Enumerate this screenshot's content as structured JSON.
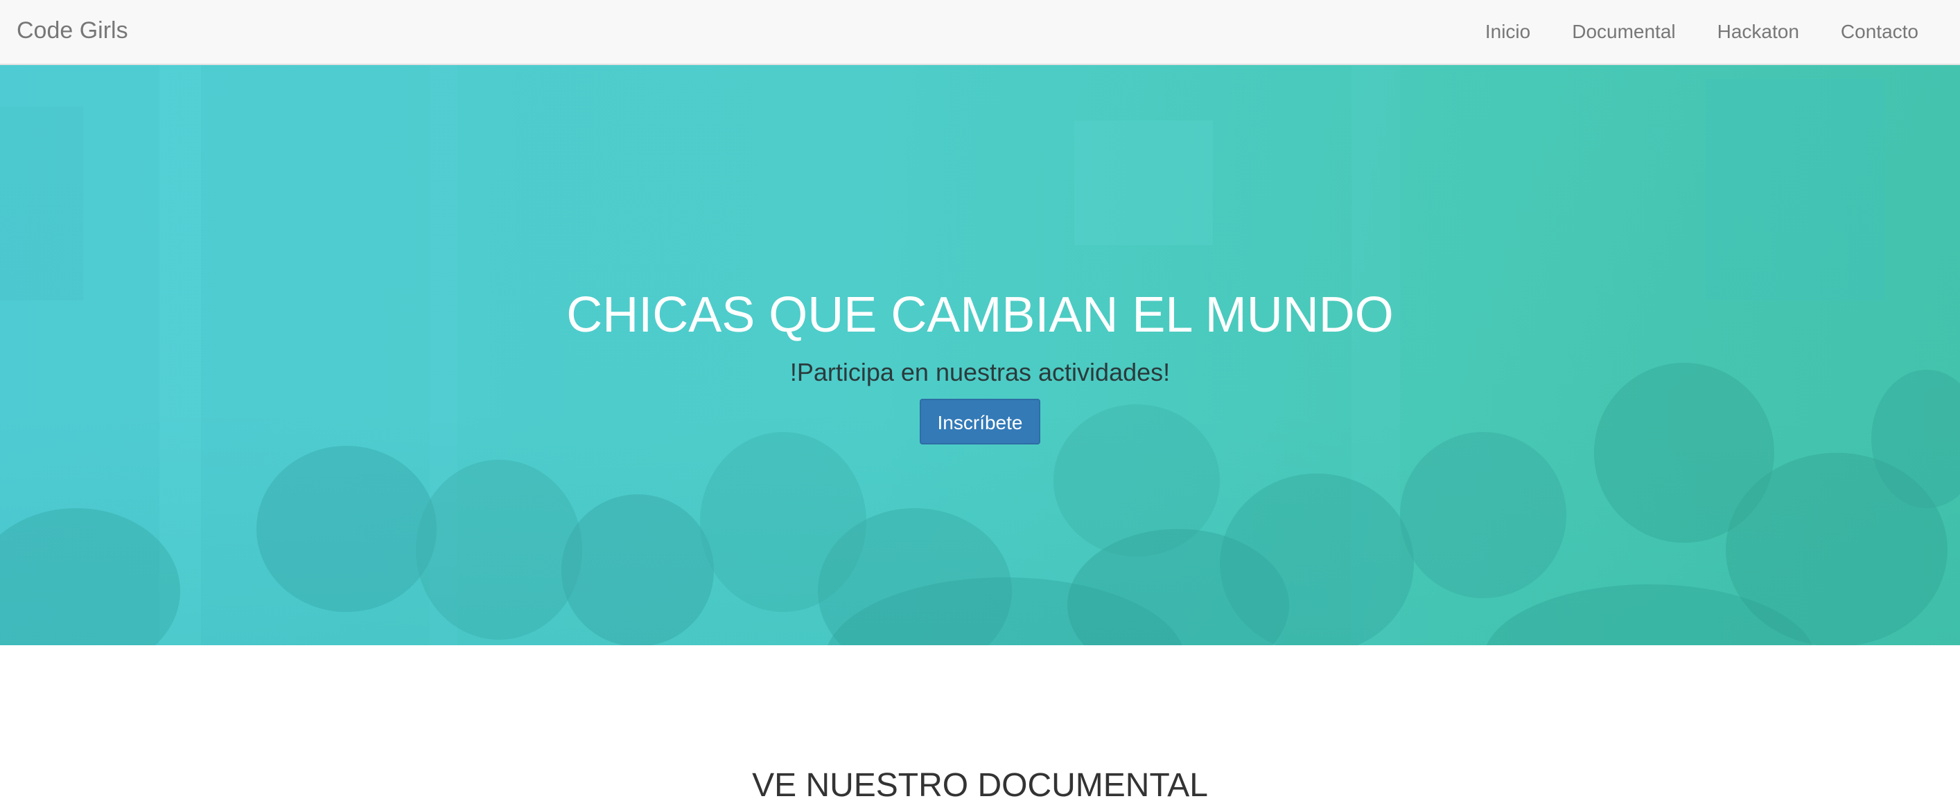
{
  "navbar": {
    "brand": "Code Girls",
    "links": [
      "Inicio",
      "Documental",
      "Hackaton",
      "Contacto"
    ]
  },
  "hero": {
    "title": "CHICAS QUE CAMBIAN EL MUNDO",
    "subtitle": "!Participa en nuestras actividades!",
    "cta_label": "Inscríbete"
  },
  "documental": {
    "title": "VE NUESTRO DOCUMENTAL"
  },
  "colors": {
    "navbar_bg": "#f8f8f8",
    "nav_text": "#777777",
    "hero_teal": "#4ecdc9",
    "cta_blue": "#337ab7"
  }
}
